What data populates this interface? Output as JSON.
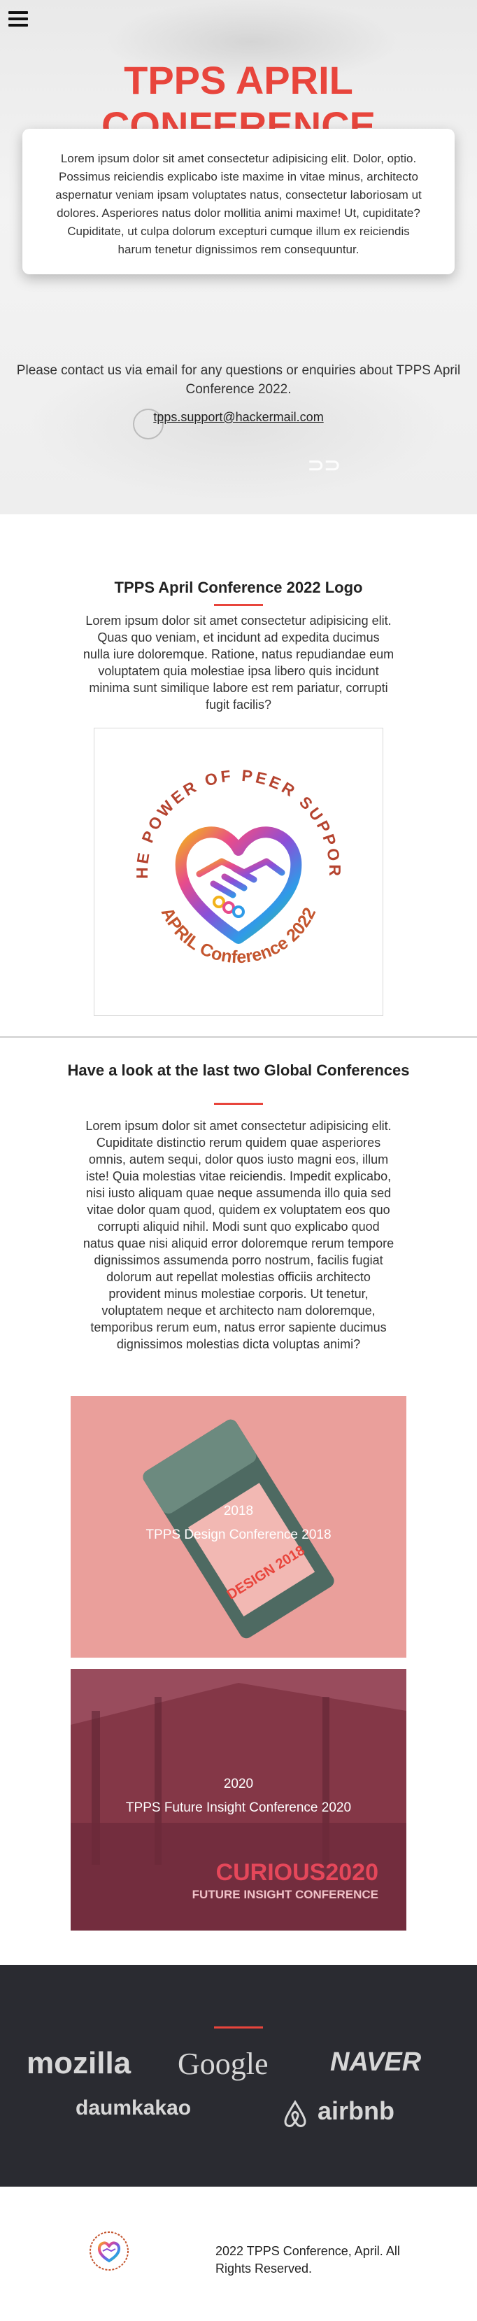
{
  "hero": {
    "title": "TPPS APRIL CONFERENCE",
    "intro": "Lorem ipsum dolor sit amet consectetur adipisicing elit. Dolor, optio. Possimus reiciendis explicabo iste maxime in vitae minus, architecto aspernatur veniam ipsam voluptates natus, consectetur laboriosam ut dolores. Asperiores natus dolor mollitia animi maxime! Ut, cupiditate? Cupiditate, ut culpa dolorum excepturi cumque illum ex reiciendis harum tenetur dignissimos rem consequuntur.",
    "contact_text": "Please contact us via email for any questions or enquiries about TPPS April Conference 2022.",
    "email": "tpps.support@hackermail.com"
  },
  "logo_section": {
    "title": "TPPS April Conference 2022 Logo",
    "text": "Lorem ipsum dolor sit amet consectetur adipisicing elit. Quas quo veniam, et incidunt ad expedita ducimus nulla iure doloremque. Ratione, natus repudiandae eum voluptatem quia molestiae ipsa libero quis incidunt minima sunt similique labore est rem pariatur, corrupti fugit facilis?",
    "badge_top": "THE POWER OF PEER SUPPORT",
    "badge_bottom": "APRIL Conference 2022"
  },
  "conferences": {
    "title": "Have a look at the last two Global Conferences",
    "text": "Lorem ipsum dolor sit amet consectetur adipisicing elit. Cupiditate distinctio rerum quidem quae asperiores omnis, autem sequi, dolor quos iusto magni eos, illum iste! Quia molestias vitae reiciendis. Impedit explicabo, nisi iusto aliquam quae neque assumenda illo quia sed vitae dolor quam quod, quidem ex voluptatem eos quo corrupti aliquid nihil. Modi sunt quo explicabo quod natus quae nisi aliquid error doloremque rerum tempore dignissimos assumenda porro nostrum, facilis fugiat dolorum aut repellat molestias officiis architecto provident minus molestiae corporis. Ut tenetur, voluptatem neque et architecto nam doloremque, temporibus rerum eum, natus error sapiente ducimus dignissimos molestias dicta voluptas animi?",
    "items": [
      {
        "year": "2018",
        "name": "TPPS Design Conference 2018",
        "poster_text": "DESIGN 2018"
      },
      {
        "year": "2020",
        "name": "TPPS Future Insight Conference 2020",
        "poster_title": "CURIOUS2020",
        "poster_sub": "FUTURE INSIGHT CONFERENCE"
      }
    ]
  },
  "partners": {
    "logos": [
      "mozilla",
      "Google",
      "NAVER",
      "daumkakao",
      "airbnb"
    ]
  },
  "footer": {
    "copyright": "2022 TPPS Conference, April. All Rights Reserved."
  }
}
